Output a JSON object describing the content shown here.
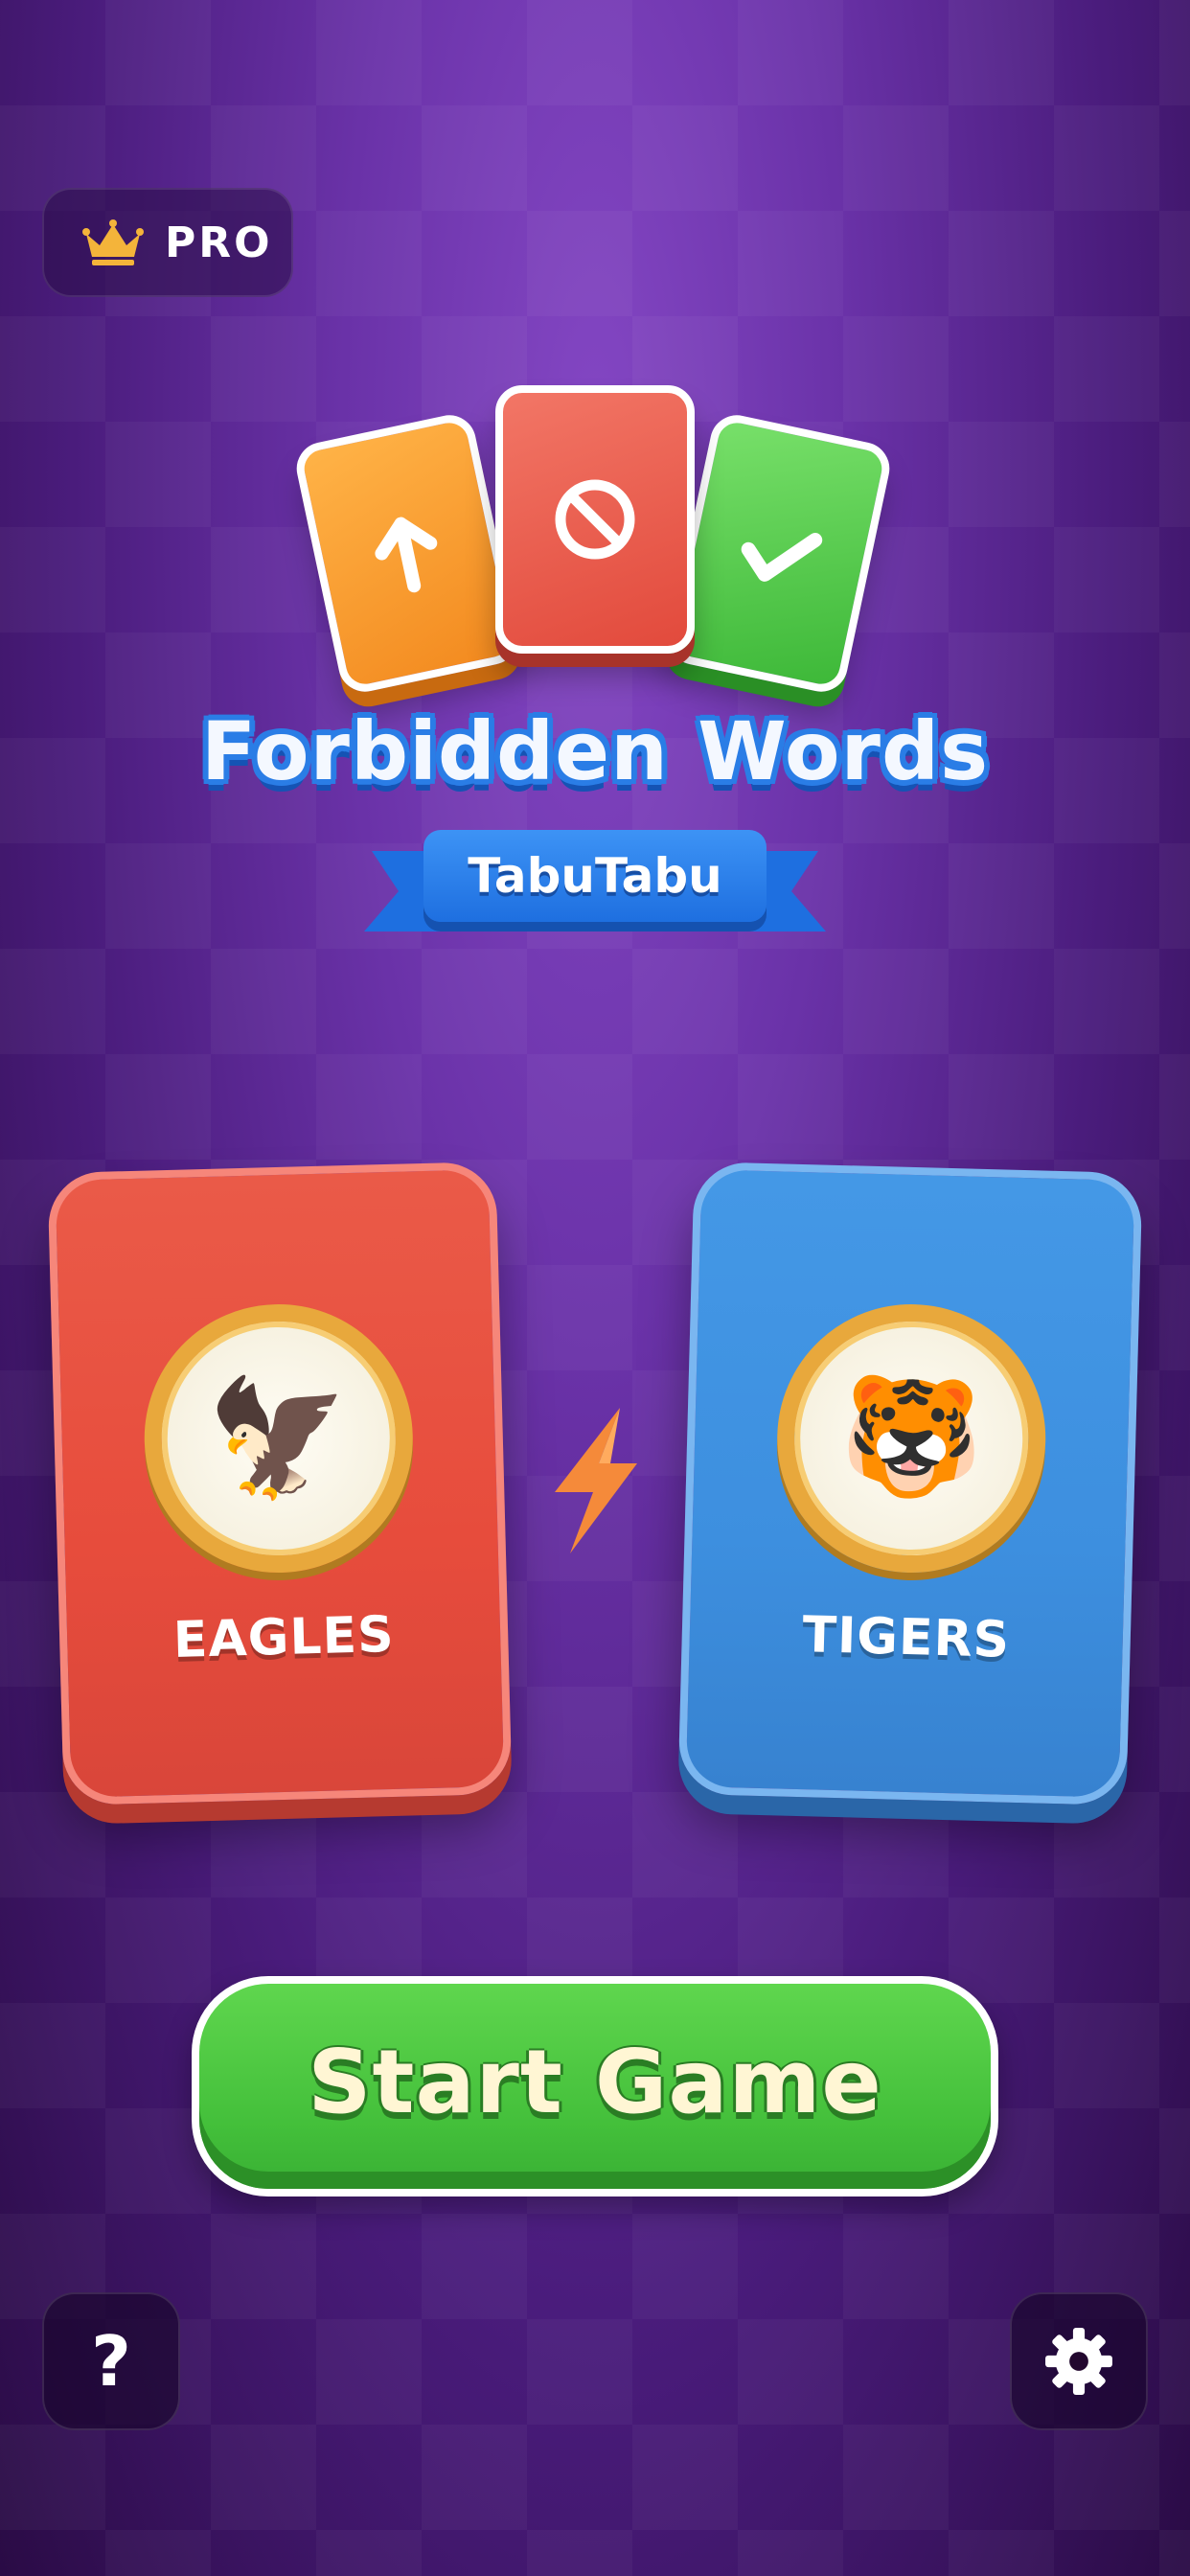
{
  "header": {
    "pro_badge_label": "PRO",
    "crown_icon": "crown-icon"
  },
  "logo": {
    "title": "Forbidden Words",
    "ribbon_label": "TabuTabu",
    "cards": [
      {
        "color": "#f7962b",
        "icon": "arrow-up-icon"
      },
      {
        "color": "#e8574a",
        "icon": "no-entry-icon"
      },
      {
        "color": "#4cc94a",
        "icon": "checkmark-icon"
      }
    ]
  },
  "teams": [
    {
      "name": "EAGLES",
      "avatar": "🦅",
      "color": "#e74c3c",
      "avatar_icon": "eagle-icon"
    },
    {
      "name": "TIGERS",
      "avatar": "🐯",
      "color": "#3d8fdf",
      "avatar_icon": "tiger-icon"
    }
  ],
  "versus_icon": "lightning-bolt-icon",
  "start_button": {
    "label": "Start Game",
    "color": "#46c23c"
  },
  "footer": {
    "help_label": "?",
    "help_icon": "question-mark-icon",
    "settings_icon": "gear-icon"
  },
  "colors": {
    "background": "#6a32a8",
    "accent_blue": "#2a7de6",
    "gold": "#e8a83c",
    "bolt": "#f58a3a"
  }
}
